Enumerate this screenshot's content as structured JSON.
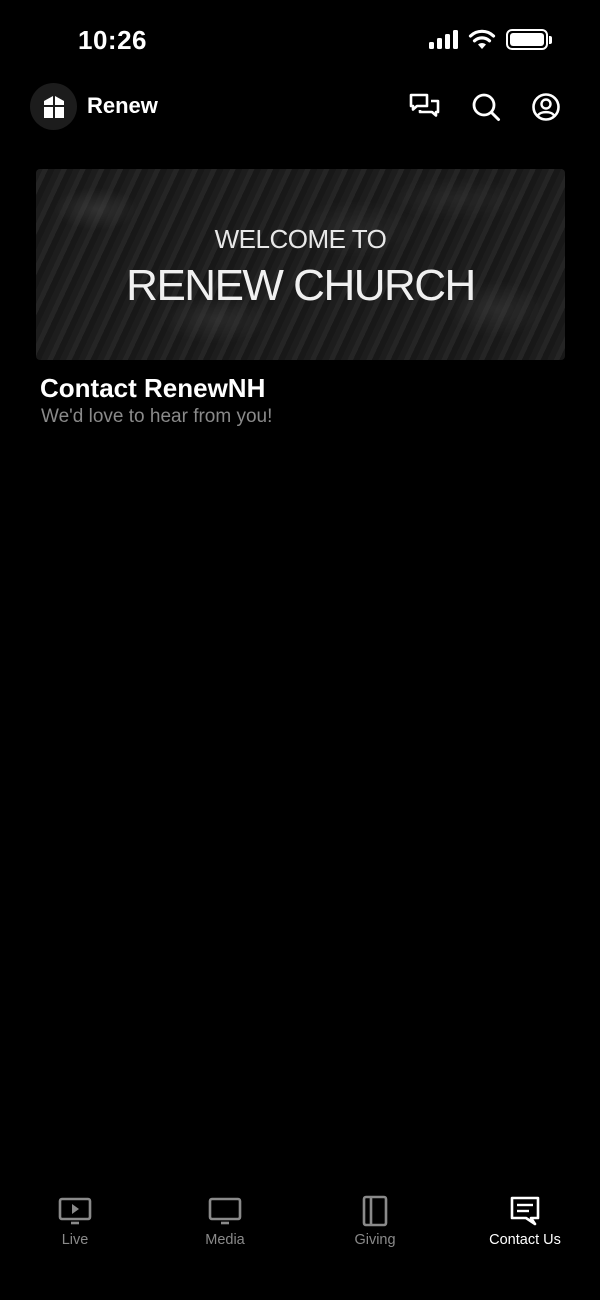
{
  "status_bar": {
    "time": "10:26"
  },
  "header": {
    "app_name": "Renew"
  },
  "banner": {
    "line1": "WELCOME TO",
    "line2": "RENEW CHURCH"
  },
  "content": {
    "title": "Contact RenewNH",
    "subtitle": "We'd love to hear from you!"
  },
  "tabs": [
    {
      "label": "Live",
      "icon": "play-screen-icon",
      "active": false
    },
    {
      "label": "Media",
      "icon": "monitor-icon",
      "active": false
    },
    {
      "label": "Giving",
      "icon": "book-icon",
      "active": false
    },
    {
      "label": "Contact Us",
      "icon": "message-icon",
      "active": true
    }
  ],
  "colors": {
    "background": "#000000",
    "inactive_tab": "#8a8a8a",
    "active_tab": "#ffffff"
  }
}
